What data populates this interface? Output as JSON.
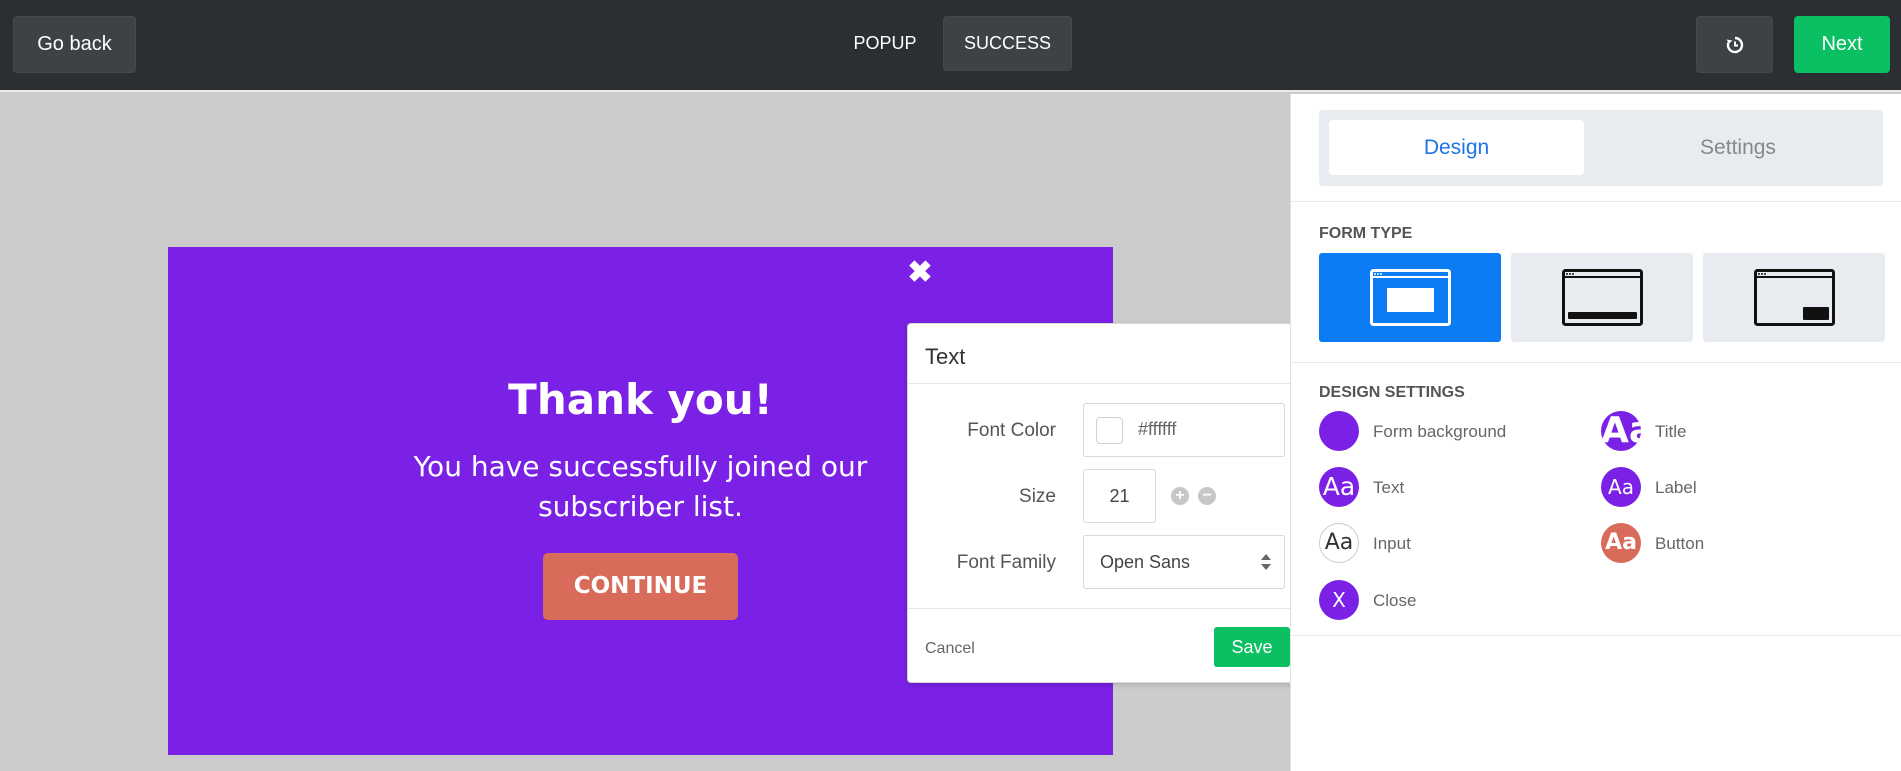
{
  "topbar": {
    "go_back": "Go back",
    "tabs": [
      "POPUP",
      "SUCCESS"
    ],
    "history_icon": "history-icon",
    "next": "Next"
  },
  "popup": {
    "background_color": "#7b21e6",
    "close_glyph": "✖",
    "title": "Thank you!",
    "text_line1": "You have successfully joined our",
    "text_line2": "subscriber list.",
    "button": "CONTINUE",
    "button_color": "#d96b5b"
  },
  "text_dialog": {
    "title": "Text",
    "font_color_label": "Font Color",
    "font_color_value": "#ffffff",
    "size_label": "Size",
    "size_value": "21",
    "plus": "+",
    "minus": "−",
    "font_family_label": "Font Family",
    "font_family_value": "Open Sans",
    "cancel": "Cancel",
    "save": "Save"
  },
  "panel": {
    "tabs": [
      "Design",
      "Settings"
    ],
    "form_type_title": "FORM TYPE",
    "design_settings_title": "DESIGN SETTINGS",
    "settings": [
      {
        "glyph": "",
        "label": "Form background"
      },
      {
        "glyph": "Aa",
        "label": "Title"
      },
      {
        "glyph": "Aa",
        "label": "Text"
      },
      {
        "glyph": "Aa",
        "label": "Label"
      },
      {
        "glyph": "Aa",
        "label": "Input"
      },
      {
        "glyph": "Aa",
        "label": "Button"
      },
      {
        "glyph": "X",
        "label": "Close"
      }
    ]
  },
  "colors": {
    "accent_green": "#0bbf63",
    "accent_blue": "#0b7cf4",
    "purple": "#7b21e6",
    "coral": "#d96b5b"
  }
}
